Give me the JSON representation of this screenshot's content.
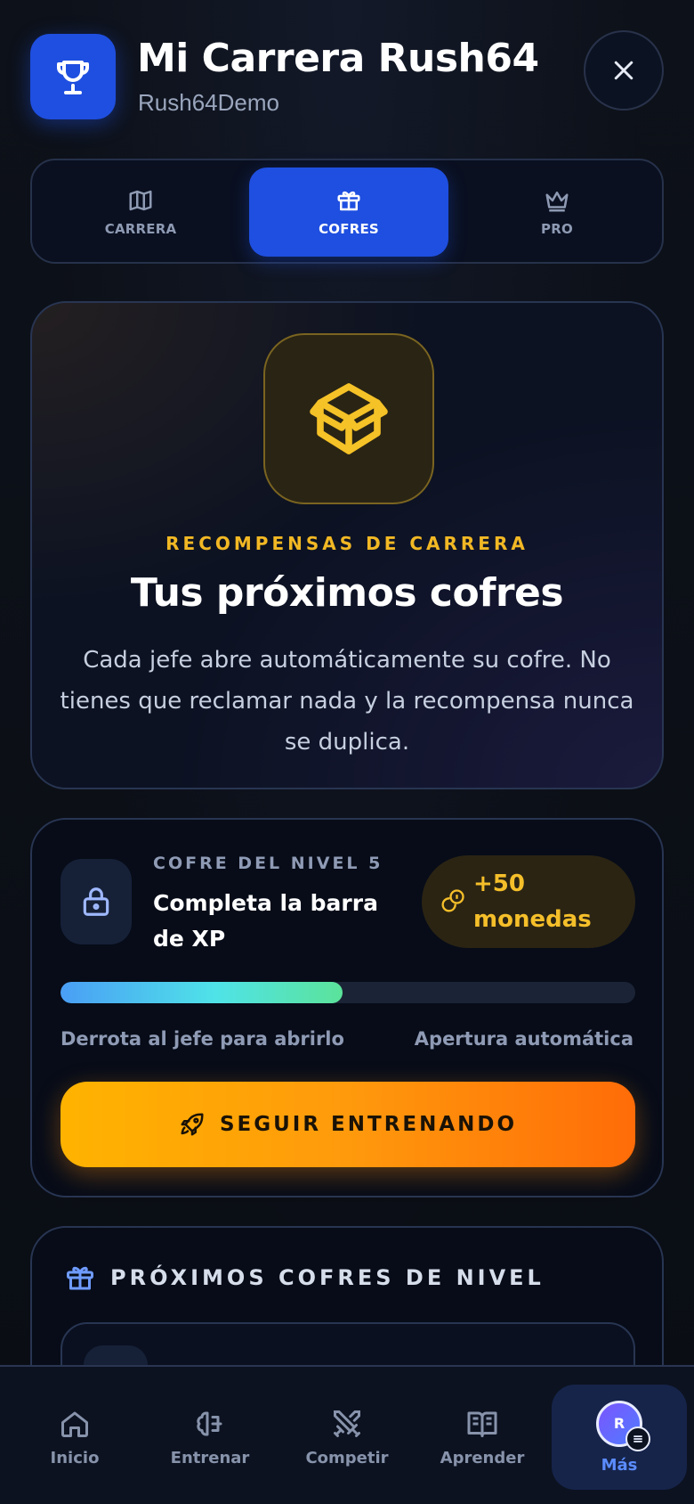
{
  "header": {
    "title": "Mi Carrera Rush64",
    "username": "Rush64Demo"
  },
  "tabs": [
    {
      "label": "CARRERA",
      "icon": "map-icon",
      "active": false
    },
    {
      "label": "COFRES",
      "icon": "gift-icon",
      "active": true
    },
    {
      "label": "PRO",
      "icon": "crown-icon",
      "active": false
    }
  ],
  "hero": {
    "icon": "box-icon",
    "eyebrow": "RECOMPENSAS DE CARRERA",
    "title": "Tus próximos cofres",
    "body": "Cada jefe abre automáticamente su cofre. No tienes que reclamar nada y la recompensa nunca se duplica."
  },
  "chest": {
    "eyebrow": "COFRE DEL NIVEL 5",
    "task": "Completa la barra de XP",
    "reward": "+50 monedas",
    "progress": 0.49,
    "hint_left": "Derrota al jefe para abrirlo",
    "hint_right": "Apertura automática",
    "button": "SEGUIR ENTRENANDO"
  },
  "next": {
    "title": "PRÓXIMOS COFRES DE NIVEL"
  },
  "nav": [
    {
      "label": "Inicio",
      "icon": "home-icon",
      "active": false
    },
    {
      "label": "Entrenar",
      "icon": "brain-icon",
      "active": false
    },
    {
      "label": "Competir",
      "icon": "swords-icon",
      "active": false
    },
    {
      "label": "Aprender",
      "icon": "book-icon",
      "active": false
    },
    {
      "label": "Más",
      "icon": "avatar",
      "active": true
    }
  ],
  "avatar_initial": "R",
  "colors": {
    "accent_blue": "#1f4fe0",
    "gold": "#f2b824",
    "orange_start": "#ffb300",
    "orange_end": "#ff6c08",
    "background": "#0b0f17"
  }
}
